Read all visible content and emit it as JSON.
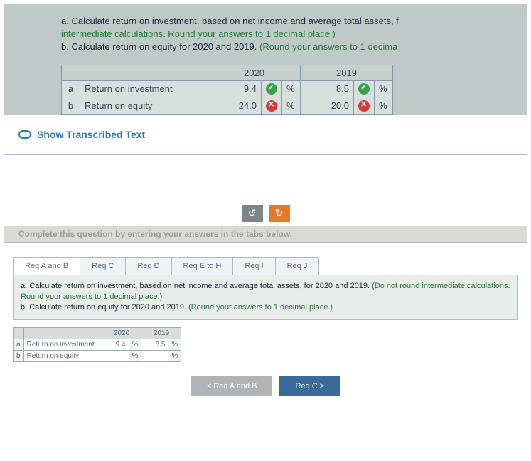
{
  "top": {
    "instr_a_prefix": "a. ",
    "instr_a_main": "Calculate return on investment, based on net income and average total assets, f",
    "instr_a_sub": "intermediate calculations. Round your answers to 1 decimal place.)",
    "instr_b_prefix": "b. ",
    "instr_b_main": "Calculate return on equity for 2020 and 2019. ",
    "instr_b_paren": "(Round your answers to 1 decima"
  },
  "results": {
    "headers": {
      "y2020": "2020",
      "y2019": "2019"
    },
    "rows": [
      {
        "id": "a",
        "label": "Return on investment",
        "v2020": "9.4",
        "status2020": "check",
        "v2019": "8.5",
        "status2019": "check"
      },
      {
        "id": "b",
        "label": "Return on equity",
        "v2020": "24.0",
        "status2020": "x",
        "v2019": "20.0",
        "status2019": "x"
      }
    ],
    "pct": "%"
  },
  "transcribed": {
    "label": "Show Transcribed Text"
  },
  "center": {
    "left": "↺",
    "right": "↻"
  },
  "bottom": {
    "complete": "Complete this question by entering your answers in the tabs below.",
    "tabs": [
      {
        "label": "Req A and B",
        "active": true
      },
      {
        "label": "Req C",
        "active": false
      },
      {
        "label": "Req D",
        "active": false
      },
      {
        "label": "Req E to H",
        "active": false
      },
      {
        "label": "Req I",
        "active": false
      },
      {
        "label": "Req J",
        "active": false
      }
    ],
    "instr_a_prefix": "a. ",
    "instr_a_main": "Calculate return on investment, based on net income and average total assets, for 2020 and 2019. ",
    "instr_a_paren": "(Do not round intermediate calculations. Round your answers to 1 decimal place.)",
    "instr_b_prefix": "b. ",
    "instr_b_main": "Calculate return on equity for 2020 and 2019. ",
    "instr_b_paren": "(Round your answers to 1 decimal place.)"
  },
  "small_table": {
    "headers": {
      "y2020": "2020",
      "y2019": "2019"
    },
    "rows": [
      {
        "id": "a",
        "label": "Return on investment",
        "v2020": "9.4",
        "v2019": "8.5"
      },
      {
        "id": "b",
        "label": "Return on equity",
        "v2020": "",
        "v2019": ""
      }
    ],
    "pct": "%"
  },
  "nav": {
    "prev": "<   Req A and B",
    "next": "Req C   >"
  }
}
